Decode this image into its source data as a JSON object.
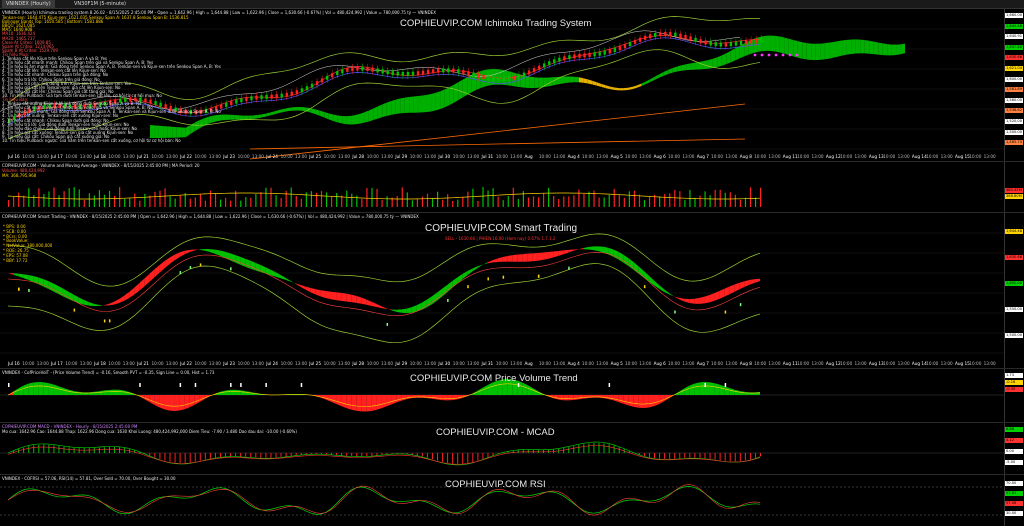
{
  "tabs": [
    {
      "label": "VNINDEX (Hourly)"
    },
    {
      "label": "VN30F1M (5-minute)"
    }
  ],
  "ichimoku": {
    "title": "COPHIEUVIP.COM Ichimoku Trading System",
    "header_line": "VNINDEX (Hourly) Ichimoku trading system 8.26.02 - 8/15/2025 2:45:00 PM - Open = 1,642.96 | High = 1,644.88 | Low = 1,622.96 | Close = 1,630.66 (-0.67%) | Vol = 480,424,992 | Value = 780,000.75 tỷ — VNINDEX",
    "info_lines": [
      {
        "text": "Tenkan-sen: 1644.475  Kijun-sen: 1621.035  Senkou Span A: 1637.8  Senkou Span B: 1536.815",
        "color": "#ffd400"
      },
      {
        "text": "Bollinger Bands Top: 1650.585 | Bottom: 1581.886",
        "color": "#ffd400"
      },
      {
        "text": "BBQ1: 1621.085",
        "color": "#ffd400"
      },
      {
        "text": "MA5: 1640.908",
        "color": "#ffd400"
      },
      {
        "text": "MA10: 1636.424",
        "color": "#ff5050"
      },
      {
        "text": "MA20: 1465.737",
        "color": "#ff5050"
      },
      {
        "text": "Close At Criteo: 1609.85",
        "color": "#ff5050"
      },
      {
        "text": "Spam At Criteo: 1214.965",
        "color": "#ff5050"
      },
      {
        "text": "Spam B At Criteo: 1529.709",
        "color": "#ff5050"
      },
      {
        "text": "Tín hiệu Mua:",
        "color": "#ff5050"
      },
      {
        "text": "1. Tenkan cắt lên Kijun trên Senkou Span A và B: Yes",
        "color": "#e8e8e8"
      },
      {
        "text": "2. Tín hiệu cắt nhanh mạnh: Chikou Span trên giá và Senkou Span A, B: Yes",
        "color": "#e8e8e8"
      },
      {
        "text": "3. Tín hiệu bị âm mạnh: Giá đóng trên Senkou Span A, B. Tenkan-sen và Kijun-sen trên Senkou Span A, B: Yes",
        "color": "#e8e8e8"
      },
      {
        "text": "4. Tín hiệu cắt lên: Tenkan-sen cắt lên Kijun-sen: No",
        "color": "#e8e8e8"
      },
      {
        "text": "5. Tín hiệu cắt nhanh: Chikou Span trên giá đóng: No",
        "color": "#e8e8e8"
      },
      {
        "text": "6. Tín hiệu trả lời: Chikou Span trên giá đóng: No",
        "color": "#e8e8e8"
      },
      {
        "text": "7. Tín hiệu trở pha: Giá đóng trên Kijun-sen trên Tenkan-sen: Yes",
        "color": "#e8e8e8"
      },
      {
        "text": "8. Tín hiệu giá cắt lên Tenkan-sen: giá cắt lên Kijun-sen: No",
        "color": "#e8e8e8"
      },
      {
        "text": "9. Tín hiệu giá cắt lên: Chikou Span giá cắt tăng giá: No",
        "color": "#e8e8e8"
      },
      {
        "text": "10. Tín hiệu Pullback: Giá tạm dưới tenkan-sen cắt lên, cơ hội từ cơ hội mua: No",
        "color": "#e8e8e8"
      },
      {
        "text": "Tín hiệu Bán:",
        "color": "#ff5050"
      },
      {
        "text": "1. Tenkan cắt xuống Kijun dưới giá đóng dưới Senkou Span A và B: No",
        "color": "#e8e8e8"
      },
      {
        "text": "2. Tín hiệu cắt nhanh mạnh: Chikou Span dưới giá và Senkou Span A, B: No",
        "color": "#e8e8e8"
      },
      {
        "text": "3. Tín hiệu bị âm mạnh: Giá đóng dưới Senkou Span A, B. Tenkan-sen và Kijun-sen dưới Senkou Span A, B: No",
        "color": "#e8e8e8"
      },
      {
        "text": "4. Tín hiệu cắt xuống: Tenkan-sen cắt xuống Kijun-sen: No",
        "color": "#e8e8e8"
      },
      {
        "text": "5. Tín hiệu cắt nhanh: Chikou Span dưới giá đóng: No",
        "color": "#e8e8e8"
      },
      {
        "text": "6. Tín hiệu trả lời: Giá đóng dưới Tenkan-sen hoặc Kijun-sen: No",
        "color": "#e8e8e8"
      },
      {
        "text": "7. Tín hiệu đảo chiều: Giá đóng dưới Tenkan-sen hoặc Kijun-sen: No",
        "color": "#e8e8e8"
      },
      {
        "text": "8. Tín hiệu giá cắt xuống: Tenkan-sen giá cắt xuống Kijun-sen: No",
        "color": "#e8e8e8"
      },
      {
        "text": "9. Tín hiệu giá cắt: Chikou Span giá cắt xuống giá: No",
        "color": "#e8e8e8"
      },
      {
        "text": "10. Tín hiệu Pullback ngược: Giá nằm trên tenkan-sen cắt xuống, cơ hội từ cơ hội bán: No",
        "color": "#e8e8e8"
      }
    ],
    "price_tags": [
      {
        "text": "1,660.00",
        "color": "#ffffff"
      },
      {
        "text": "1,644.48",
        "color": "#00d000"
      },
      {
        "text": "1,640.91",
        "color": "#ffffff"
      },
      {
        "text": "1,637.80",
        "color": "#00d000"
      },
      {
        "text": "1,630.66",
        "color": "#ff3030"
      },
      {
        "text": "1,621.04",
        "color": "#ffd400"
      },
      {
        "text": "1,600.00",
        "color": "#ffffff"
      },
      {
        "text": "1,581.89",
        "color": "#ff8040"
      },
      {
        "text": "1,560.00",
        "color": "#ffffff"
      },
      {
        "text": "1,536.82",
        "color": "#ff8040"
      },
      {
        "text": "1,520.00",
        "color": "#ffffff"
      },
      {
        "text": "1,500.00",
        "color": "#ffffff"
      },
      {
        "text": "1,465.74",
        "color": "#ff8040"
      }
    ]
  },
  "volume": {
    "header_line": "COPHIEUVIP.COM - Volume and Moving Average - VNINDEX - 8/15/2025 2:45:00 PM | MA Period: 20",
    "volume_line": "Volume: 480,424,992",
    "ma_line": "MA: 368,795,968",
    "tags": [
      {
        "text": "480.42M",
        "color": "#ff3030"
      },
      {
        "text": "368.80M",
        "color": "#ffd400"
      }
    ]
  },
  "smart": {
    "title": "COPHIEUVIP.COM Smart Trading",
    "header_line": "COPHIEUVIP.COM Smart Trading - VNINDEX - 8/15/2025 2:45:00 PM | Open = 1,642.96 | High = 1,644.88 | Low = 1,622.96 | Close = 1,630.66 (-0.67%) | Vol = 480,424,992 | Value = 780,000.75 tỷ — VNINDEX",
    "subtitle": "SELL - 1630.66 | PHIEN 16:00 (Hom nay) 0.67% 1.7.1.2",
    "info_lines": [
      {
        "text": "* BPS:  0.00",
        "color": "#ffd400"
      },
      {
        "text": "* SCB:  0.00",
        "color": "#ffd400"
      },
      {
        "text": "* BCrs:  0.00",
        "color": "#ffd400"
      },
      {
        "text": "* BookValue:",
        "color": "#ffd400"
      },
      {
        "text": "* NetValue: 380,000,000",
        "color": "#ffd400"
      },
      {
        "text": "* ROE:  26.75",
        "color": "#ffd400"
      },
      {
        "text": "* EPS:  57.08",
        "color": "#ffd400"
      },
      {
        "text": "* BBY:  17.72",
        "color": "#ffd400"
      }
    ],
    "tags": [
      {
        "text": "1,644.48",
        "color": "#ffd400"
      },
      {
        "text": "1,630.66",
        "color": "#ff3030"
      },
      {
        "text": "1,600.00",
        "color": "#00d000"
      },
      {
        "text": "1,550.00",
        "color": "#ffffff"
      },
      {
        "text": "1,500.00",
        "color": "#ffffff"
      }
    ]
  },
  "pvt": {
    "title": "COPHIEUVIP.COM Price Volume Trend",
    "header_line": "VNINDEX - CofPriceVolT - (Price Volume Trend) = -0.16, Smooth PVT = -0.35, Sign Line = 0.00, Hist = 1.73",
    "tags": [
      {
        "text": "1.73",
        "color": "#ffffff"
      },
      {
        "text": "-0.16",
        "color": "#ffd400"
      },
      {
        "text": "-0.35",
        "color": "#ff3030"
      }
    ]
  },
  "macd": {
    "title": "COPHIEUVIP.COM - MCAD",
    "header_line": "COPHIEUVIP.COM MACD - VNINDEX - Hourly - 8/15/2025 2:45:00 PM",
    "value_line": "Mo cua: 1642.96  Cao: 1644.88  Thap: 1622.96  Dong cua: 1630  Khoi Luong: 480,424,992,000  Diem Tieu: -7.90 / 3.480  Dao dau dai: -10.00 (-0.60%)",
    "tags": [
      {
        "text": "6.68",
        "color": "#00d000"
      },
      {
        "text": "4.12",
        "color": "#ff3030"
      },
      {
        "text": "0.00",
        "color": "#ffffff"
      },
      {
        "text": "-5.00",
        "color": "#ffffff"
      }
    ]
  },
  "rsi": {
    "title": "COPHIEUVIP.COM RSI",
    "header_line": "VNINDEX - COFRSI = 57.06, RSI(14) = 57.81, Over Sold = 70.00, Over Bought = 30.00",
    "tags": [
      {
        "text": "70.00",
        "color": "#ffffff"
      },
      {
        "text": "57.81",
        "color": "#00d000"
      },
      {
        "text": "57.06",
        "color": "#ff3030"
      },
      {
        "text": "30.00",
        "color": "#ffffff"
      }
    ]
  },
  "dates": [
    "Jul 16",
    "10:00",
    "13:00",
    "Jul 17",
    "10:00",
    "13:00",
    "Jul 18",
    "10:00",
    "13:00",
    "Jul 21",
    "10:00",
    "13:00",
    "Jul 22",
    "10:00",
    "13:00",
    "Jul 23",
    "10:00",
    "13:00",
    "Jul 24",
    "10:00",
    "13:00",
    "Jul 25",
    "10:00",
    "13:00",
    "Jul 28",
    "10:00",
    "13:00",
    "Jul 29",
    "10:00",
    "13:00",
    "Jul 30",
    "10:00",
    "13:00",
    "Jul 31",
    "10:00",
    "13:00",
    "Aug",
    "10:00",
    "13:00",
    "Aug 4",
    "10:00",
    "13:00",
    "Aug 5",
    "10:00",
    "13:00",
    "Aug 6",
    "10:00",
    "13:00",
    "Aug 7",
    "10:00",
    "13:00",
    "Aug 8",
    "10:00",
    "13:00",
    "Aug 11",
    "10:00",
    "13:00",
    "Aug 12",
    "10:00",
    "13:00",
    "Aug 13",
    "10:00",
    "13:00",
    "Aug 14",
    "10:00",
    "13:00",
    "Aug 15",
    "10:00",
    "13:00"
  ],
  "colors": {
    "up": "#00c000",
    "down": "#ff2020",
    "cloud_bull": "#00b000",
    "cloud_bear": "#e8b000",
    "text": "#e8e8e8"
  }
}
